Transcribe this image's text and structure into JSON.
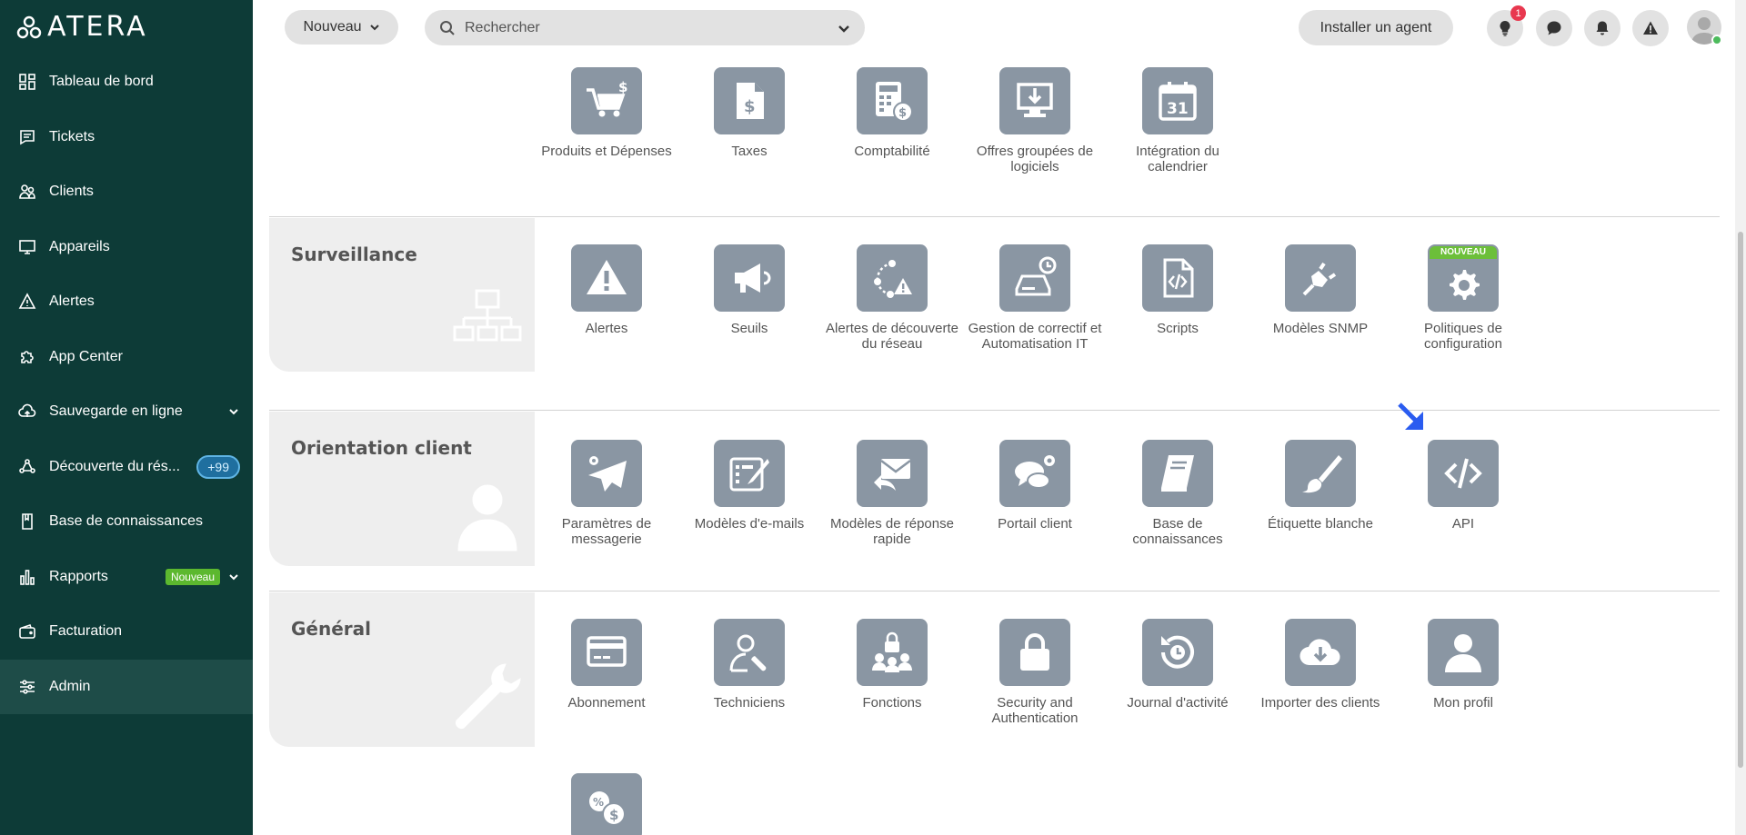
{
  "brand": {
    "name": "ATERA"
  },
  "sidebar": {
    "items": [
      {
        "label": "Tableau de bord",
        "icon": "dashboard-icon"
      },
      {
        "label": "Tickets",
        "icon": "ticket-icon"
      },
      {
        "label": "Clients",
        "icon": "clients-icon"
      },
      {
        "label": "Appareils",
        "icon": "monitor-icon"
      },
      {
        "label": "Alertes",
        "icon": "alert-icon"
      },
      {
        "label": "App Center",
        "icon": "puzzle-icon"
      },
      {
        "label": "Sauvegarde en ligne",
        "icon": "cloud-upload-icon"
      },
      {
        "label": "Découverte du rés...",
        "icon": "network-discovery-icon",
        "badge": "+99"
      },
      {
        "label": "Base de connaissances",
        "icon": "book-icon"
      },
      {
        "label": "Rapports",
        "icon": "bar-chart-icon",
        "badge": "Nouveau"
      },
      {
        "label": "Facturation",
        "icon": "wallet-icon"
      },
      {
        "label": "Admin",
        "icon": "sliders-icon"
      }
    ]
  },
  "topbar": {
    "new_label": "Nouveau",
    "search_placeholder": "Rechercher",
    "install_agent_label": "Installer un agent",
    "notification_count": "1"
  },
  "sections": {
    "billing": {
      "tiles": [
        {
          "label": "Produits et Dépenses",
          "icon": "cart-dollar-icon"
        },
        {
          "label": "Taxes",
          "icon": "tax-document-icon"
        },
        {
          "label": "Comptabilité",
          "icon": "calculator-icon"
        },
        {
          "label": "Offres groupées de logiciels",
          "icon": "software-bundle-icon"
        },
        {
          "label": "Intégration du calendrier",
          "icon": "calendar-icon",
          "day": "31"
        }
      ]
    },
    "surveillance": {
      "title": "Surveillance",
      "tiles": [
        {
          "label": "Alertes",
          "icon": "warning-icon"
        },
        {
          "label": "Seuils",
          "icon": "megaphone-icon"
        },
        {
          "label": "Alertes de découverte du réseau",
          "icon": "network-alert-icon"
        },
        {
          "label": "Gestion de correctif et Automatisation IT",
          "icon": "patch-management-icon"
        },
        {
          "label": "Scripts",
          "icon": "script-file-icon"
        },
        {
          "label": "Modèles SNMP",
          "icon": "plug-icon"
        },
        {
          "label": "Politiques de configuration",
          "icon": "gear-icon",
          "tag": "NOUVEAU"
        }
      ]
    },
    "orientation": {
      "title": "Orientation client",
      "tiles": [
        {
          "label": "Paramètres de messagerie",
          "icon": "paper-plane-gear-icon"
        },
        {
          "label": "Modèles d'e-mails",
          "icon": "email-template-icon"
        },
        {
          "label": "Modèles de réponse rapide",
          "icon": "quick-reply-icon"
        },
        {
          "label": "Portail client",
          "icon": "chat-gear-icon"
        },
        {
          "label": "Base de connaissances",
          "icon": "book-icon"
        },
        {
          "label": "Étiquette blanche",
          "icon": "paintbrush-icon"
        },
        {
          "label": "API",
          "icon": "code-icon"
        }
      ]
    },
    "general": {
      "title": "Général",
      "tiles": [
        {
          "label": "Abonnement",
          "icon": "credit-card-icon"
        },
        {
          "label": "Techniciens",
          "icon": "technician-icon"
        },
        {
          "label": "Fonctions",
          "icon": "roles-lock-icon"
        },
        {
          "label": "Security and Authentication",
          "icon": "lock-icon"
        },
        {
          "label": "Journal d'activité",
          "icon": "history-icon"
        },
        {
          "label": "Importer des clients",
          "icon": "cloud-download-icon"
        },
        {
          "label": "Mon profil",
          "icon": "user-icon"
        },
        {
          "label": "",
          "icon": "currency-exchange-icon"
        }
      ]
    }
  },
  "colors": {
    "sidebar_bg": "#0d3b37",
    "tile_bg": "#8a96a3",
    "accent_green": "#5cb82f",
    "pointer_arrow": "#2a5cf0"
  }
}
